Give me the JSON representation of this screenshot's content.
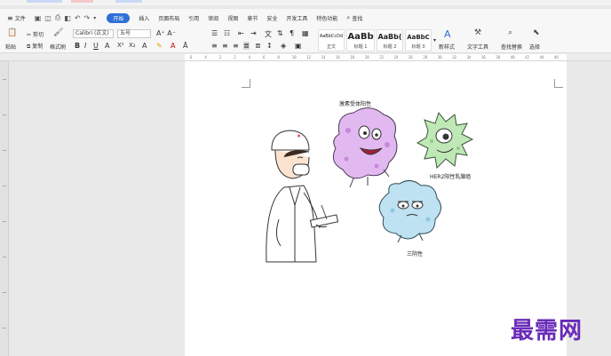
{
  "menu": {
    "file": "文件",
    "tabs": [
      "开始",
      "插入",
      "页面布局",
      "引用",
      "审阅",
      "视图",
      "章节",
      "安全",
      "开发工具",
      "特色功能"
    ],
    "active_tab": "开始",
    "search": "查找"
  },
  "ribbon": {
    "paste": "粘贴",
    "cut": "剪切",
    "copy": "复制",
    "format_painter": "格式刷",
    "font_name": "Calibri (正文)",
    "font_size": "五号",
    "styles": [
      {
        "sample": "AaBbCcDd",
        "name": "正文"
      },
      {
        "sample": "AaBb",
        "name": "标题 1"
      },
      {
        "sample": "AaBb(",
        "name": "标题 2"
      },
      {
        "sample": "AaBbC",
        "name": "标题 3"
      }
    ],
    "new_style": "新样式",
    "text_tools": "文字工具",
    "find_replace": "查找替换",
    "select": "选择"
  },
  "ruler": {
    "ticks": [
      "6",
      "4",
      "2",
      "2",
      "4",
      "6",
      "8",
      "10",
      "12",
      "14",
      "16",
      "18",
      "20",
      "22",
      "24",
      "26",
      "28",
      "30",
      "32",
      "34",
      "36",
      "38",
      "40",
      "42",
      "44",
      "46"
    ]
  },
  "document": {
    "label_hormone": "激素受体阳性",
    "label_her2": "HER2阳性乳腺癌",
    "label_triple": "三阴性"
  },
  "watermark": "最需网",
  "colors": {
    "active_tab": "#2f6fd6",
    "watermark": "#6a2bb8",
    "purple_cell": "#e2b8f0",
    "green_cell": "#bfe8b6",
    "blue_cell": "#bfe2f2"
  }
}
